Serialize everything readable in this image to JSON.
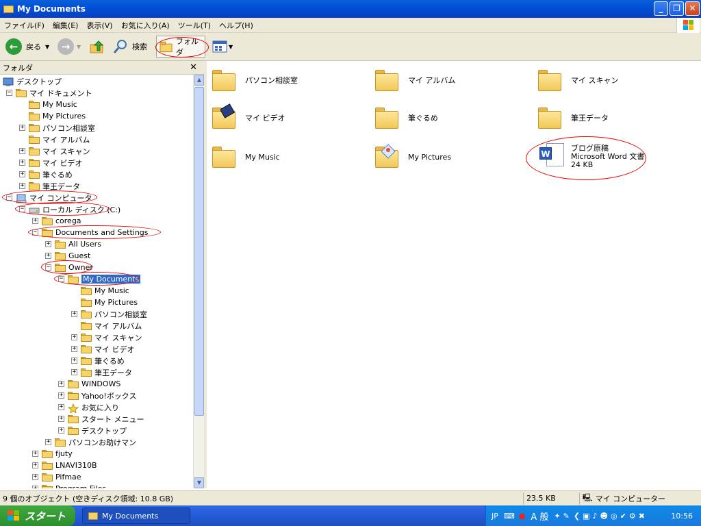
{
  "window": {
    "title": "My Documents"
  },
  "menubar": [
    "ファイル(F)",
    "編集(E)",
    "表示(V)",
    "お気に入り(A)",
    "ツール(T)",
    "ヘルプ(H)"
  ],
  "toolbar": {
    "back": "戻る",
    "search": "検索",
    "folders": "フォルダ"
  },
  "folder_pane": {
    "title": "フォルダ"
  },
  "tree": [
    {
      "label": "デスクトップ",
      "depth": 0,
      "expander": "",
      "icon": "desktop-icon",
      "marked": false,
      "selected": false
    },
    {
      "label": "マイ ドキュメント",
      "depth": 1,
      "expander": "-",
      "icon": "my-documents-icon",
      "marked": false,
      "selected": false
    },
    {
      "label": "My Music",
      "depth": 2,
      "expander": "",
      "icon": "folder-icon",
      "marked": false,
      "selected": false
    },
    {
      "label": "My Pictures",
      "depth": 2,
      "expander": "",
      "icon": "folder-icon",
      "marked": false,
      "selected": false
    },
    {
      "label": "パソコン相談室",
      "depth": 2,
      "expander": "+",
      "icon": "folder-icon",
      "marked": false,
      "selected": false
    },
    {
      "label": "マイ アルバム",
      "depth": 2,
      "expander": "",
      "icon": "folder-icon",
      "marked": false,
      "selected": false
    },
    {
      "label": "マイ スキャン",
      "depth": 2,
      "expander": "+",
      "icon": "folder-icon",
      "marked": false,
      "selected": false
    },
    {
      "label": "マイ ビデオ",
      "depth": 2,
      "expander": "+",
      "icon": "folder-icon",
      "marked": false,
      "selected": false
    },
    {
      "label": "筆ぐるめ",
      "depth": 2,
      "expander": "+",
      "icon": "folder-icon",
      "marked": false,
      "selected": false
    },
    {
      "label": "筆王データ",
      "depth": 2,
      "expander": "+",
      "icon": "folder-icon",
      "marked": false,
      "selected": false
    },
    {
      "label": "マイ コンピュータ",
      "depth": 1,
      "expander": "-",
      "icon": "computer-icon",
      "marked": true,
      "selected": false
    },
    {
      "label": "ローカル ディスク (C:)",
      "depth": 2,
      "expander": "-",
      "icon": "drive-icon",
      "marked": true,
      "selected": false
    },
    {
      "label": "corega",
      "depth": 3,
      "expander": "+",
      "icon": "folder-icon",
      "marked": false,
      "selected": false
    },
    {
      "label": "Documents and Settings",
      "depth": 3,
      "expander": "-",
      "icon": "folder-icon",
      "marked": true,
      "selected": false
    },
    {
      "label": "All Users",
      "depth": 4,
      "expander": "+",
      "icon": "folder-icon",
      "marked": false,
      "selected": false
    },
    {
      "label": "Guest",
      "depth": 4,
      "expander": "+",
      "icon": "folder-icon",
      "marked": false,
      "selected": false
    },
    {
      "label": "Owner",
      "depth": 4,
      "expander": "-",
      "icon": "folder-icon",
      "marked": true,
      "selected": false
    },
    {
      "label": "My Documents",
      "depth": 5,
      "expander": "-",
      "icon": "folder-icon",
      "marked": true,
      "selected": true
    },
    {
      "label": "My Music",
      "depth": 6,
      "expander": "",
      "icon": "folder-icon",
      "marked": false,
      "selected": false
    },
    {
      "label": "My Pictures",
      "depth": 6,
      "expander": "",
      "icon": "folder-icon",
      "marked": false,
      "selected": false
    },
    {
      "label": "パソコン相談室",
      "depth": 6,
      "expander": "+",
      "icon": "folder-icon",
      "marked": false,
      "selected": false
    },
    {
      "label": "マイ アルバム",
      "depth": 6,
      "expander": "",
      "icon": "folder-icon",
      "marked": false,
      "selected": false
    },
    {
      "label": "マイ スキャン",
      "depth": 6,
      "expander": "+",
      "icon": "folder-icon",
      "marked": false,
      "selected": false
    },
    {
      "label": "マイ ビデオ",
      "depth": 6,
      "expander": "+",
      "icon": "folder-icon",
      "marked": false,
      "selected": false
    },
    {
      "label": "筆ぐるめ",
      "depth": 6,
      "expander": "+",
      "icon": "folder-icon",
      "marked": false,
      "selected": false
    },
    {
      "label": "筆王データ",
      "depth": 6,
      "expander": "+",
      "icon": "folder-icon",
      "marked": false,
      "selected": false
    },
    {
      "label": "WINDOWS",
      "depth": 5,
      "expander": "+",
      "icon": "folder-icon",
      "marked": false,
      "selected": false
    },
    {
      "label": "Yahoo!ボックス",
      "depth": 5,
      "expander": "+",
      "icon": "folder-icon",
      "marked": false,
      "selected": false
    },
    {
      "label": "お気に入り",
      "depth": 5,
      "expander": "+",
      "icon": "favorites-icon",
      "marked": false,
      "selected": false
    },
    {
      "label": "スタート メニュー",
      "depth": 5,
      "expander": "+",
      "icon": "folder-icon",
      "marked": false,
      "selected": false
    },
    {
      "label": "デスクトップ",
      "depth": 5,
      "expander": "+",
      "icon": "folder-icon",
      "marked": false,
      "selected": false
    },
    {
      "label": "パソコンお助けマン",
      "depth": 4,
      "expander": "+",
      "icon": "folder-icon",
      "marked": false,
      "selected": false
    },
    {
      "label": "fjuty",
      "depth": 3,
      "expander": "+",
      "icon": "folder-icon",
      "marked": false,
      "selected": false
    },
    {
      "label": "LNAVI310B",
      "depth": 3,
      "expander": "+",
      "icon": "folder-icon",
      "marked": false,
      "selected": false
    },
    {
      "label": "Pifmae",
      "depth": 3,
      "expander": "+",
      "icon": "folder-icon",
      "marked": false,
      "selected": false
    },
    {
      "label": "Program Files",
      "depth": 3,
      "expander": "+",
      "icon": "folder-icon",
      "marked": false,
      "selected": false
    }
  ],
  "content_items": [
    {
      "name": "パソコン相談室",
      "type": "folder",
      "col": 0,
      "row": 0
    },
    {
      "name": "マイ アルバム",
      "type": "folder",
      "col": 1,
      "row": 0
    },
    {
      "name": "マイ スキャン",
      "type": "folder",
      "col": 2,
      "row": 0
    },
    {
      "name": "マイ ビデオ",
      "type": "video-folder",
      "col": 0,
      "row": 1
    },
    {
      "name": "筆ぐるめ",
      "type": "folder",
      "col": 1,
      "row": 1
    },
    {
      "name": "筆王データ",
      "type": "folder",
      "col": 2,
      "row": 1
    },
    {
      "name": "My Music",
      "type": "folder",
      "col": 0,
      "row": 2
    },
    {
      "name": "My Pictures",
      "type": "pictures-folder",
      "col": 1,
      "row": 2
    },
    {
      "name": "ブログ原稿",
      "type": "word-document",
      "detail": "Microsoft Word 文書",
      "size": "24 KB",
      "col": 2,
      "row": 2
    }
  ],
  "statusbar": {
    "objects": "9 個のオブジェクト (空きディスク領域: 10.8 GB)",
    "size": "23.5 KB",
    "location": "マイ コンピューター"
  },
  "taskbar": {
    "start": "スタート",
    "task": "My Documents",
    "ime_lang": "JP",
    "ime_mode": "A 般",
    "clock": "10:56"
  },
  "colors": {
    "highlight_oval": "#e00000",
    "selection": "#316ac5",
    "titlebar": "#0050d8"
  }
}
